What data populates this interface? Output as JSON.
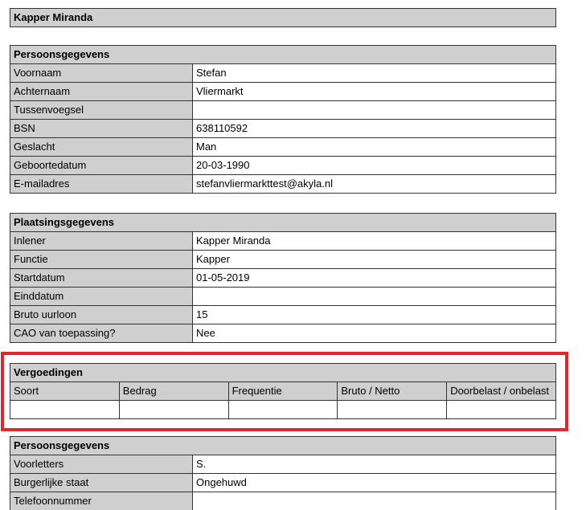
{
  "title": "Kapper Miranda",
  "personal": {
    "header": "Persoonsgegevens",
    "rows": [
      {
        "label": "Voornaam",
        "value": "Stefan"
      },
      {
        "label": "Achternaam",
        "value": "Vliermarkt"
      },
      {
        "label": "Tussenvoegsel",
        "value": ""
      },
      {
        "label": "BSN",
        "value": "638110592"
      },
      {
        "label": "Geslacht",
        "value": "Man"
      },
      {
        "label": "Geboortedatum",
        "value": "20-03-1990"
      },
      {
        "label": "E-mailadres",
        "value": "stefanvliermarkttest@akyla.nl"
      }
    ]
  },
  "placement": {
    "header": "Plaatsingsgegevens",
    "rows": [
      {
        "label": "Inlener",
        "value": "Kapper Miranda"
      },
      {
        "label": "Functie",
        "value": "Kapper"
      },
      {
        "label": "Startdatum",
        "value": "01-05-2019"
      },
      {
        "label": "Einddatum",
        "value": ""
      },
      {
        "label": "Bruto uurloon",
        "value": "15"
      },
      {
        "label": "CAO van toepassing?",
        "value": "Nee"
      }
    ]
  },
  "allowances": {
    "header": "Vergoedingen",
    "columns": [
      "Soort",
      "Bedrag",
      "Frequentie",
      "Bruto / Netto",
      "Doorbelast / onbelast"
    ]
  },
  "personal2": {
    "header": "Persoonsgegevens",
    "rows": [
      {
        "label": "Voorletters",
        "value": "S."
      },
      {
        "label": "Burgerlijke staat",
        "value": "Ongehuwd"
      },
      {
        "label": "Telefoonnummer",
        "value": ""
      }
    ]
  },
  "colors": {
    "header_bg": "#cfcfcf",
    "border": "#333333",
    "highlight": "#e3262d"
  }
}
